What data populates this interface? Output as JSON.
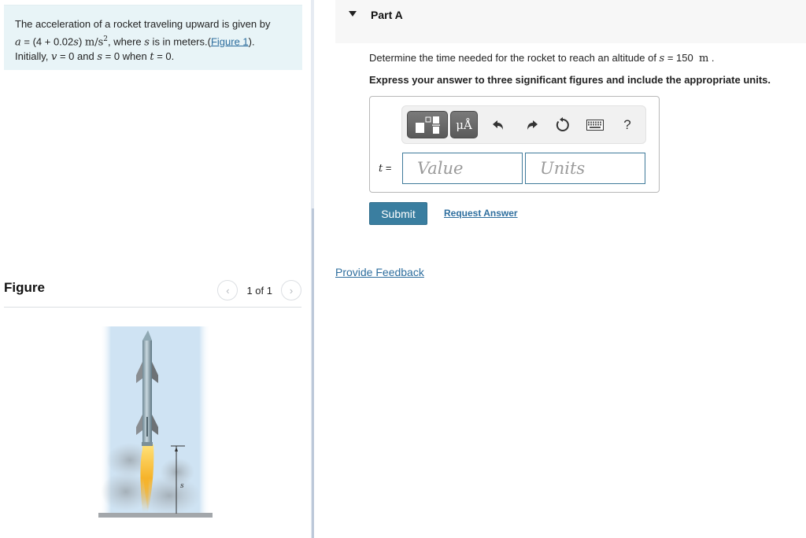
{
  "problem": {
    "intro": "The acceleration of a rocket traveling upward is given by",
    "accel_var": "a",
    "accel_expr_open": " = (4 + 0.02",
    "accel_s": "s",
    "accel_expr_close": ") ",
    "accel_units": "m/s",
    "accel_units_exp": "2",
    "where_text": ", where ",
    "where_s": "s",
    "meters_text": " is in meters.(",
    "figure_link": "Figure 1",
    "close_paren": ").",
    "initially": "Initially, ",
    "v_var": "v",
    "v_eq": " = 0 and ",
    "s_var": "s",
    "s_eq": " = 0 when ",
    "t_var": "t",
    "t_eq": " = 0."
  },
  "figure": {
    "title": "Figure",
    "pager_text": "1 of 1",
    "prev_icon": "chevron-left",
    "next_icon": "chevron-right",
    "image_label": "s"
  },
  "part": {
    "title": "Part A",
    "question_prefix": "Determine the time needed for the rocket to reach an altitude of ",
    "question_var": "s",
    "question_eq": " = 150  ",
    "question_unit": "m",
    "question_end": " .",
    "instructions": "Express your answer to three significant figures and include the appropriate units."
  },
  "answer": {
    "variable": "t",
    "equals": " =",
    "value_placeholder": "Value",
    "units_placeholder": "Units",
    "toolbar": {
      "templates_icon": "templates",
      "units_label": "μÅ",
      "undo_icon": "undo",
      "redo_icon": "redo",
      "reset_icon": "reset",
      "keyboard_icon": "keyboard",
      "help_label": "?"
    }
  },
  "actions": {
    "submit_label": "Submit",
    "request_answer_label": "Request Answer",
    "feedback_label": "Provide Feedback"
  },
  "colors": {
    "accent": "#3a7ea0",
    "link": "#2e6e9e",
    "problem_bg": "#e8f4f7"
  }
}
